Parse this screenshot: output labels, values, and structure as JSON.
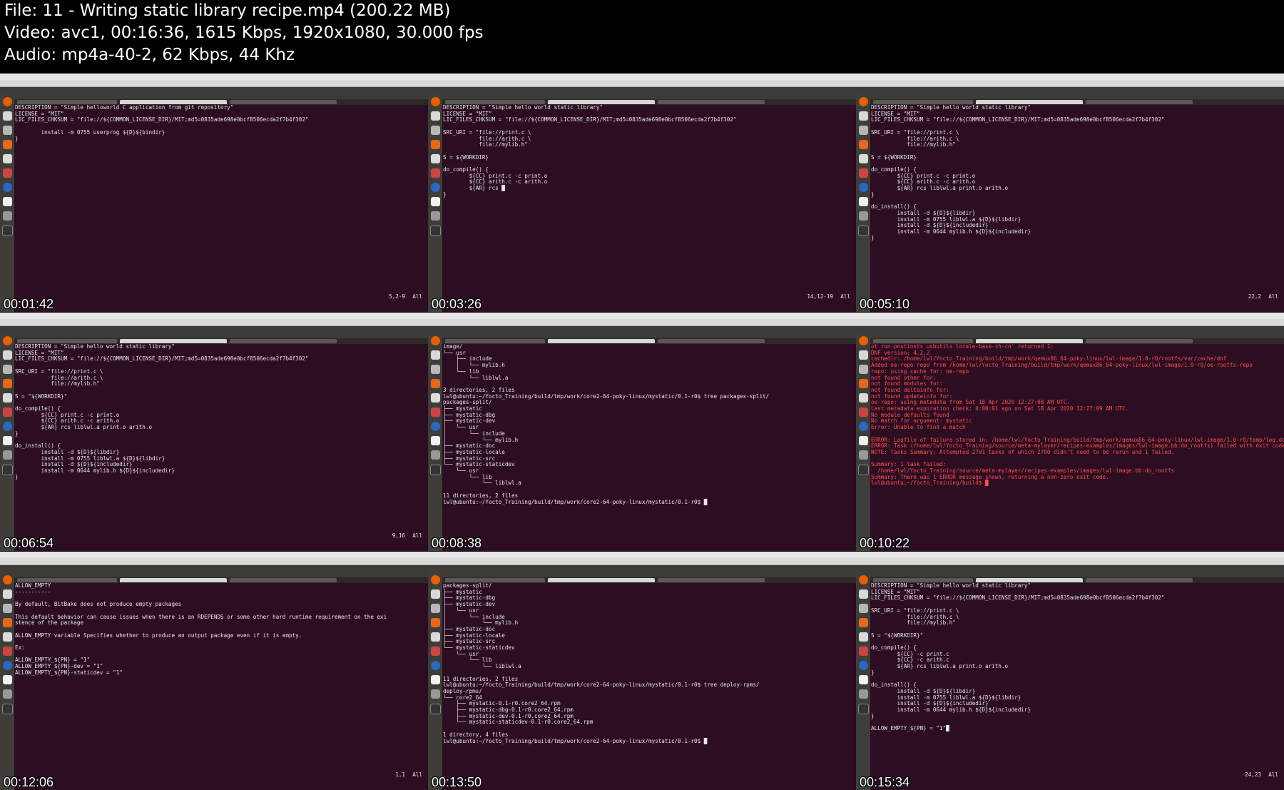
{
  "header": {
    "file_line": "File: 11 - Writing static library recipe.mp4 (200.22 MB)",
    "video_line": "Video: avc1, 00:16:36, 1615 Kbps, 1920x1080, 30.000 fps",
    "audio_line": "Audio: mp4a-40-2, 62 Kbps, 44 Khz"
  },
  "thumbnails": [
    {
      "timestamp": "00:01:42",
      "vim_pos": "5,2-9",
      "vim_all": "All",
      "terminal": "DESCRIPTION = \"Simple helloworld C application from git repository\"\nLICENSE = \"MIT\"\nLIC_FILES_CHKSUM = \"file://${COMMON_LICENSE_DIR}/MIT;md5=0835ade698e0bcf8506ecda2f7b4f302\"\n\n        install -m 0755 userprog ${D}${bindir}\n}"
    },
    {
      "timestamp": "00:03:26",
      "vim_pos": "14,12-19",
      "vim_all": "All",
      "terminal": "DESCRIPTION = \"Simple hello world static library\"\nLICENSE = \"MIT\"\nLIC_FILES_CHKSUM = \"file://${COMMON_LICENSE_DIR}/MIT;md5=0835ade698e0bcf8506ecda2f7b4f302\"\n\nSRC_URI = \"file://print.c \\\n           file://arith.c \\\n           file://mylib.h\"\n\nS = ${WORKDIR}\n\ndo_compile() {\n        ${CC} print.c -c print.o\n        ${CC} arith.c -c arith.o\n        ${AR} rcs █\n}"
    },
    {
      "timestamp": "00:05:10",
      "vim_pos": "22,2",
      "vim_all": "All",
      "terminal": "DESCRIPTION = \"Simple hello world static library\"\nLICENSE = \"MIT\"\nLIC_FILES_CHKSUM = \"file://${COMMON_LICENSE_DIR}/MIT;md5=0835ade698e0bcf8506ecda2f7b4f302\"\n\nSRC_URI = \"file://print.c \\\n           file://arith.c \\\n           file://mylib.h\"\n\nS = ${WORKDIR}\n\ndo_compile() {\n        ${CC} print.c -c print.o\n        ${CC} arith.c -c arith.o\n        ${AR} rcs liblwl.a print.o arith.o\n}\n\ndo_install() {\n        install -d ${D}${libdir}\n        install -m 0755 liblwl.a ${D}${libdir}\n        install -d ${D}${includedir}\n        install -m 0644 mylib.h ${D}${includedir}\n}"
    },
    {
      "timestamp": "00:06:54",
      "vim_pos": "9,16",
      "vim_all": "All",
      "terminal": "DESCRIPTION = \"Simple hello world static library\"\nLICENSE = \"MIT\"\nLIC_FILES_CHKSUM = \"file://${COMMON_LICENSE_DIR}/MIT;md5=0835ade698e0bcf8506ecda2f7b4f302\"\n\nSRC_URI = \"file://print.c \\\n           file://arith.c \\\n           file://mylib.h\"\n\nS = \"${WORKDIR}\"\n\ndo_compile() {\n        ${CC} print.c -c print.o\n        ${CC} arith.c -c arith.o\n        ${AR} rcs liblwl.a print.o arith.o\n}\n\ndo_install() {\n        install -d ${D}${libdir}\n        install -m 0755 liblwl.a ${D}${libdir}\n        install -d ${D}${includedir}\n        install -m 0644 mylib.h ${D}${includedir}\n}"
    },
    {
      "timestamp": "00:08:38",
      "vim_pos": "",
      "vim_all": "",
      "terminal": "image/\n└── usr\n    ├── include\n    │   └── mylib.h\n    └── lib\n        └── liblwl.a\n\n3 directories, 2 files\nlwl@ubuntu:~/Yocto_Training/build/tmp/work/core2-64-poky-linux/mystatic/0.1-r0$ tree packages-split/\npackages-split/\n├── mystatic\n├── mystatic-dbg\n├── mystatic-dev\n│   └── usr\n│       └── include\n│           └── mylib.h\n├── mystatic-doc\n├── mystatic-locale\n├── mystatic-src\n└── mystatic-staticdev\n    └── usr\n        └── lib\n            └── liblwl.a\n\n11 directories, 2 files\nlwl@ubuntu:~/Yocto_Training/build/tmp/work/core2-64-poky-linux/mystatic/0.1-r0$ █"
    },
    {
      "timestamp": "00:10:22",
      "vim_pos": "",
      "vim_all": "",
      "terminal": "ot run-postinsts usbutils locale-base-zh-cn' returned 1:\nDNF version: 4.2.2\ncachedir: /home/lwl/Yocto_Training/build/tmp/work/qemux86_64-poky-linux/lwl-image/1.0-r0/rootfs/var/cache/dnf\nAdded oe-repo repo from /home/lwl/Yocto_Training/build/tmp/work/qemux86_64-poky-linux/lwl-image/1.0-r0/oe-rootfs-repo\nrepo: using cache for: oe-repo\nnot found other for:\nnot found modules for:\nnot found deltainfo for:\nnot found updateinfo for:\noe-repo: using metadata from Sat 18 Apr 2020 12:27:08 AM UTC.\nLast metadata expiration check: 0:00:01 ago on Sat 18 Apr 2020 12:27:09 AM UTC.\nNo module defaults found\nNo match for argument: mystatic\nError: Unable to find a match\n\nERROR: Logfile of failure stored in: /home/lwl/Yocto_Training/build/tmp/work/qemux86_64-poky-linux/lwl-image/1.0-r0/temp/log.do_rootfs.78794\nERROR: Task (/home/lwl/Yocto_Training/source/meta-mylayer/recipes-examples/images/lwl-image.bb:do_rootfs) failed with exit code '1'\nNOTE: Tasks Summary: Attempted 2701 tasks of which 2700 didn't need to be rerun and 1 failed.\n\nSummary: 1 task failed:\n  /home/lwl/Yocto_Training/source/meta-mylayer/recipes-examples/images/lwl-image.bb:do_rootfs\nSummary: There was 1 ERROR message shown, returning a non-zero exit code.\nlwl@ubuntu:~/Yocto_Training/build$ █"
    },
    {
      "timestamp": "00:12:06",
      "vim_pos": "1,1",
      "vim_all": "All",
      "terminal": "ALLOW_EMPTY\n-----------\n\nBy default, BitBake does not produce empty packages\n\nThis default behavior can cause issues when there is an RDEPENDS or some other hard runtime requirement on the exi\nstence of the package\n\nALLOW_EMPTY variable Specifies whether to produce an output package even if it is empty.\n\nEx:\n\nALLOW_EMPTY_${PN} = \"1\"\nALLOW_EMPTY_${PN}-dev = \"1\"\nALLOW_EMPTY_${PN}-staticdev = \"1\""
    },
    {
      "timestamp": "00:13:50",
      "vim_pos": "",
      "vim_all": "",
      "terminal": "packages-split/\n├── mystatic\n├── mystatic-dbg\n├── mystatic-dev\n│   └── usr\n│       └── include\n│           └── mylib.h\n├── mystatic-doc\n├── mystatic-locale\n├── mystatic-src\n└── mystatic-staticdev\n    └── usr\n        └── lib\n            └── liblwl.a\n\n11 directories, 2 files\nlwl@ubuntu:~/Yocto_Training/build/tmp/work/core2-64-poky-linux/mystatic/0.1-r0$ tree deploy-rpms/\ndeploy-rpms/\n└── core2_64\n    ├── mystatic-0.1-r0.core2_64.rpm\n    ├── mystatic-dbg-0.1-r0.core2_64.rpm\n    ├── mystatic-dev-0.1-r0.core2_64.rpm\n    └── mystatic-staticdev-0.1-r0.core2_64.rpm\n\n1 directory, 4 files\nlwl@ubuntu:~/Yocto_Training/build/tmp/work/core2-64-poky-linux/mystatic/0.1-r0$ █"
    },
    {
      "timestamp": "00:15:34",
      "vim_pos": "24,23",
      "vim_all": "All",
      "terminal": "DESCRIPTION = \"Simple hello world static library\"\nLICENSE = \"MIT\"\nLIC_FILES_CHKSUM = \"file://${COMMON_LICENSE_DIR}/MIT;md5=0835ade698e0bcf8506ecda2f7b4f302\"\n\nSRC_URI = \"file://print.c \\\n           file://arith.c \\\n           file://mylib.h\"\n\nS = \"${WORKDIR}\"\n\ndo_compile() {\n        ${CC} -c print.c\n        ${CC} -c arith.c\n        ${AR} rcs liblwl.a print.o arith.o\n}\n\ndo_install() {\n        install -d ${D}${libdir}\n        install -m 0755 liblwl.a ${D}${libdir}\n        install -d ${D}${includedir}\n        install -m 0644 mylib.h ${D}${includedir}\n}\n\nALLOW_EMPTY_${PN} = \"1\"█"
    }
  ]
}
